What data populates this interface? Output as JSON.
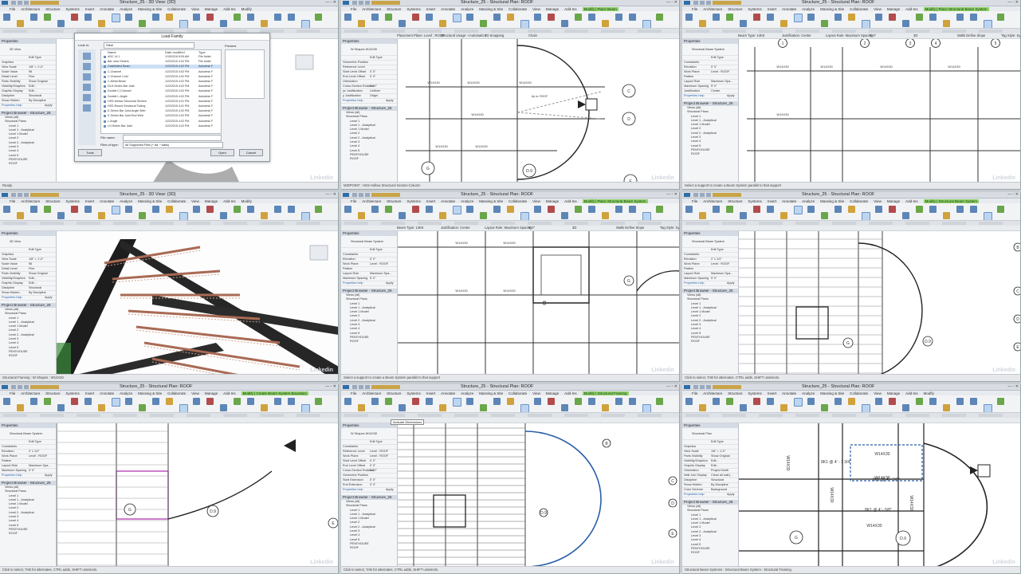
{
  "panels": [
    {
      "title": "Structure_25 - 3D View: {3D}",
      "tabs": [
        "File",
        "Architecture",
        "Structure",
        "Systems",
        "Insert",
        "Annotate",
        "Analyze",
        "Massing & Site",
        "Collaborate",
        "View",
        "Manage",
        "Add-Ins",
        "Modify"
      ],
      "properties_header": "Properties",
      "view_type": "3D View",
      "prop_rows": [
        [
          "Graphics",
          ""
        ],
        [
          "View Scale",
          "1/8\" = 1'-0\""
        ],
        [
          "Scale Value",
          "96"
        ],
        [
          "Detail Level",
          "Fine"
        ],
        [
          "Parts Visibility",
          "Show Original"
        ],
        [
          "Visibility/Graphics",
          "Edit..."
        ],
        [
          "Graphic Display",
          "Edit..."
        ],
        [
          "Discipline",
          "Structural"
        ],
        [
          "Show Hidden",
          "By Discipline"
        ]
      ],
      "browser_header": "Project Browser - Structure_25",
      "tree": [
        "Views (all)",
        "Structural Plans",
        "Level 1",
        "Level 1 - Analytical",
        "Level 1 Model",
        "Level 2",
        "Level 2 - Analytical",
        "Level 3",
        "Level 4",
        "Level 5",
        "PENTHOUSE",
        "ROOF"
      ],
      "status": "Ready",
      "dialog": {
        "title": "Load Family",
        "look_in_label": "Look in:",
        "look_in": "Steel",
        "columns": [
          "Name",
          "Date modified",
          "Type"
        ],
        "files": [
          [
            "ASC 14.1",
            "1/15/2016 8:05 AM",
            "File folder"
          ],
          [
            "Bar Joist Girders",
            "1/22/2015 4:02 PM",
            "File folder"
          ],
          [
            "Castellated Beam",
            "1/22/2015 4:02 PM",
            "Autodesk F"
          ],
          [
            "C-Channel",
            "1/22/2015 4:02 PM",
            "Autodesk F"
          ],
          [
            "C-Channel Cold",
            "1/22/2015 4:02 PM",
            "Autodesk F"
          ],
          [
            "C-Metal Beam",
            "1/22/2015 4:02 PM",
            "Autodesk F"
          ],
          [
            "DLH-Series Bar Joist",
            "1/22/2015 4:02 PM",
            "Autodesk F"
          ],
          [
            "Double C-Channel",
            "1/22/2015 4:02 PM",
            "Autodesk F"
          ],
          [
            "Double L-Angle",
            "1/22/2015 4:02 PM",
            "Autodesk F"
          ],
          [
            "HSS-Hollow Structural Section",
            "1/22/2015 4:01 PM",
            "Autodesk F"
          ],
          [
            "HSS-Round Structural Tubing",
            "1/22/2015 4:01 PM",
            "Autodesk F"
          ],
          [
            "K-Series Bar Joist-Angle Web",
            "1/22/2015 4:02 PM",
            "Autodesk F"
          ],
          [
            "K-Series Bar Joist-Rod Web",
            "1/22/2015 4:02 PM",
            "Autodesk F"
          ],
          [
            "L-Angle",
            "1/22/2015 4:02 PM",
            "Autodesk F"
          ],
          [
            "LH-Series Bar Joist",
            "1/22/2015 4:02 PM",
            "Autodesk F"
          ]
        ],
        "places": [
          "Documents",
          "My Computer",
          "My Network Places",
          "Favorites",
          "Desktop",
          "Metric Library"
        ],
        "preview_label": "Preview",
        "file_name_label": "File name:",
        "files_of_type_label": "Files of type:",
        "files_of_type": "All Supported Files (*.rfa, *.adsk)",
        "tools_label": "Tools",
        "open_label": "Open",
        "cancel_label": "Cancel"
      }
    },
    {
      "title": "Structure_25 - Structural Plan: ROOF",
      "tabs": [
        "File",
        "Architecture",
        "Structure",
        "Systems",
        "Insert",
        "Annotate",
        "Analyze",
        "Massing & Site",
        "Collaborate",
        "View",
        "Manage",
        "Add-Ins",
        "Modify | Place Beam"
      ],
      "options": [
        "Placement Plane: Level : ROOF",
        "Structural Usage: <Automatic>",
        "3D Snapping",
        "Chain"
      ],
      "properties_header": "Properties",
      "view_type": "W Shapes W14X30",
      "prop_rows": [
        [
          "Geometric Position",
          ""
        ],
        [
          "Reference Level",
          ""
        ],
        [
          "Start Level Offset",
          "0' 0\""
        ],
        [
          "End Level Offset",
          "0' 0\""
        ],
        [
          "Orientation",
          ""
        ],
        [
          "Cross-Section Rotation",
          "0.00°"
        ],
        [
          "yz Justification",
          "Uniform"
        ],
        [
          "y Justification",
          "Origin"
        ]
      ],
      "browser_header": "Project Browser - Structure_25",
      "tree": [
        "Views (all)",
        "Structural Plans",
        "Level 1",
        "Level 1 - Analytical",
        "Level 1 Model",
        "Level 2",
        "Level 2 - Analytical",
        "Level 3",
        "Level 4",
        "Level 5",
        "PENTHOUSE",
        "ROOF"
      ],
      "status": "MIDPOINT : HSS-Hollow Structural Section-Column",
      "beam_labels": [
        "W14X30",
        "W14X30",
        "W14X30",
        "W14X30",
        "W14X30",
        "W14X30"
      ],
      "grid_bubbles": [
        "C",
        "D",
        "G",
        "D.9",
        "E"
      ],
      "tip": "Up to: ROOF"
    },
    {
      "title": "Structure_25 - Structural Plan: ROOF",
      "tabs": [
        "File",
        "Architecture",
        "Structure",
        "Systems",
        "Insert",
        "Annotate",
        "Analyze",
        "Massing & Site",
        "Collaborate",
        "View",
        "Manage",
        "Add-Ins",
        "Modify | Place Structural Beam System"
      ],
      "options": [
        "Beam Type: 14K6",
        "Justification: Center",
        "Layout Rule: Maximum Spacing",
        "5' 0\"",
        "3D",
        "Walls Define Slope",
        "Tag Style: System"
      ],
      "properties_header": "Properties",
      "view_type": "Structural Beam System",
      "prop_rows": [
        [
          "Constraints",
          ""
        ],
        [
          "Elevation",
          "0' 0\""
        ],
        [
          "Work Plane",
          "Level : ROOF"
        ],
        [
          "Pattern",
          ""
        ],
        [
          "Layout Rule",
          "Maximum Spa..."
        ],
        [
          "Maximum Spacing",
          "5' 0\""
        ],
        [
          "Justification",
          "Center"
        ]
      ],
      "browser_header": "Project Browser - Structure_25",
      "tree": [
        "Views (all)",
        "Structural Plans",
        "Level 1",
        "Level 1 - Analytical",
        "Level 1 Model",
        "Level 2",
        "Level 2 - Analytical",
        "Level 3",
        "Level 4",
        "Level 5",
        "PENTHOUSE",
        "ROOF"
      ],
      "status": "Select a support to create a Beam System parallel to that support",
      "grid_bubbles": [
        "1",
        "2",
        "3",
        "4",
        "5"
      ],
      "beam_labels": [
        "W14X30",
        "W14X30",
        "W14X30",
        "W14X30",
        "W14X30"
      ]
    },
    {
      "title": "Structure_25 - 3D View: {3D}",
      "tabs": [
        "File",
        "Architecture",
        "Structure",
        "Systems",
        "Insert",
        "Annotate",
        "Analyze",
        "Massing & Site",
        "Collaborate",
        "View",
        "Manage",
        "Add-Ins",
        "Modify"
      ],
      "properties_header": "Properties",
      "view_type": "3D View",
      "prop_rows": [
        [
          "Graphics",
          ""
        ],
        [
          "View Scale",
          "1/8\" = 1'-0\""
        ],
        [
          "Scale Value",
          "96"
        ],
        [
          "Detail Level",
          "Fine"
        ],
        [
          "Parts Visibility",
          "Show Original"
        ],
        [
          "Visibility/Graphics",
          "Edit..."
        ],
        [
          "Graphic Display",
          "Edit..."
        ],
        [
          "Discipline",
          "Structural"
        ],
        [
          "Show Hidden",
          "By Discipline"
        ]
      ],
      "browser_header": "Project Browser - Structure_25",
      "tree": [
        "Views (all)",
        "Structural Plans",
        "Level 1",
        "Level 1 - Analytical",
        "Level 1 Model",
        "Level 2",
        "Level 2 - Analytical",
        "Level 3",
        "Level 4",
        "Level 5",
        "PENTHOUSE",
        "ROOF"
      ],
      "status": "Structural Framing : W Shapes : W14X30"
    },
    {
      "title": "Structure_25 - Structural Plan: ROOF",
      "tabs": [
        "File",
        "Architecture",
        "Structure",
        "Systems",
        "Insert",
        "Annotate",
        "Analyze",
        "Massing & Site",
        "Collaborate",
        "View",
        "Manage",
        "Add-Ins",
        "Modify | Place Structural Beam System"
      ],
      "options": [
        "Beam Type: 14K6",
        "Justification: Center",
        "Layout Rule: Maximum Spacing",
        "5' 0\"",
        "3D",
        "Walls Define Slope",
        "Tag Style: System"
      ],
      "properties_header": "Properties",
      "view_type": "Structural Beam System",
      "prop_rows": [
        [
          "Constraints",
          ""
        ],
        [
          "Elevation",
          "0' 0\""
        ],
        [
          "Work Plane",
          "Level : ROOF"
        ],
        [
          "Pattern",
          ""
        ],
        [
          "Layout Rule",
          "Maximum Spa..."
        ],
        [
          "Maximum Spacing",
          "5' 0\""
        ]
      ],
      "browser_header": "Project Browser - Structure_25",
      "tree": [
        "Views (all)",
        "Structural Plans",
        "Level 1",
        "Level 1 - Analytical",
        "Level 1 Model",
        "Level 2",
        "Level 2 - Analytical",
        "Level 3",
        "Level 4",
        "Level 5",
        "PENTHOUSE",
        "ROOF"
      ],
      "status": "Select a support to create a Beam System parallel to that support",
      "beam_labels": [
        "W14X30",
        "W14X30",
        "W14X30",
        "W14X30"
      ],
      "grid_bubbles": [
        "G"
      ]
    },
    {
      "title": "Structure_25 - Structural Plan: ROOF",
      "tabs": [
        "File",
        "Architecture",
        "Structure",
        "Systems",
        "Insert",
        "Annotate",
        "Analyze",
        "Massing & Site",
        "Collaborate",
        "View",
        "Manage",
        "Add-Ins",
        "Modify | Structural Beam System"
      ],
      "properties_header": "Properties",
      "view_type": "Structural Beam System",
      "prop_rows": [
        [
          "Constraints",
          ""
        ],
        [
          "Elevation",
          "2' 1 1/2\""
        ],
        [
          "Work Plane",
          "Level : ROOF"
        ],
        [
          "Pattern",
          ""
        ],
        [
          "Layout Rule",
          "Maximum Spa..."
        ],
        [
          "Maximum Spacing",
          "5' 0\""
        ]
      ],
      "browser_header": "Project Browser - Structure_25",
      "tree": [
        "Views (all)",
        "Structural Plans",
        "Level 1",
        "Level 1 - Analytical",
        "Level 1 Model",
        "Level 2",
        "Level 2 - Analytical",
        "Level 3",
        "Level 4",
        "Level 5",
        "PENTHOUSE",
        "ROOF"
      ],
      "status": "Click to select, TAB for alternates, CTRL adds, SHIFT unselects.",
      "grid_bubbles": [
        "B",
        "C",
        "D",
        "E",
        "D.9",
        "G"
      ]
    },
    {
      "title": "Structure_25 - Structural Plan: ROOF",
      "tabs": [
        "File",
        "Architecture",
        "Structure",
        "Systems",
        "Insert",
        "Annotate",
        "Analyze",
        "Massing & Site",
        "Collaborate",
        "View",
        "Manage",
        "Add-Ins",
        "Modify | Create Beam System Boundary"
      ],
      "properties_header": "Properties",
      "view_type": "Structural Beam System",
      "prop_rows": [
        [
          "Constraints",
          ""
        ],
        [
          "Elevation",
          "2' 1 1/2\""
        ],
        [
          "Work Plane",
          "Level : ROOF"
        ],
        [
          "Pattern",
          ""
        ],
        [
          "Layout Rule",
          "Maximum Spa..."
        ],
        [
          "Maximum Spacing",
          "5' 0\""
        ]
      ],
      "browser_header": "Project Browser - Structure_25",
      "tree": [
        "Views (all)",
        "Structural Plans",
        "Level 1",
        "Level 1 - Analytical",
        "Level 1 Model",
        "Level 2",
        "Level 2 - Analytical",
        "Level 3",
        "Level 4",
        "Level 5",
        "PENTHOUSE",
        "ROOF"
      ],
      "status": "Click to select, TAB for alternates, CTRL adds, SHIFT unselects.",
      "grid_bubbles": [
        "G",
        "D.9",
        "E"
      ]
    },
    {
      "title": "Structure_25 - Structural Plan: ROOF",
      "tabs": [
        "File",
        "Architecture",
        "Structure",
        "Systems",
        "Insert",
        "Annotate",
        "Analyze",
        "Massing & Site",
        "Collaborate",
        "View",
        "Manage",
        "Add-Ins",
        "Modify | Structural Framing"
      ],
      "properties_header": "Properties",
      "view_type": "W Shapes W14X30",
      "prop_rows": [
        [
          "Constraints",
          ""
        ],
        [
          "Reference Level",
          "Level : ROOF"
        ],
        [
          "Work Plane",
          "Level : ROOF"
        ],
        [
          "Start Level Offset",
          "0' 0\""
        ],
        [
          "End Level Offset",
          "0' 0\""
        ],
        [
          "Cross-Section Rotation",
          "0.00°"
        ],
        [
          "Geometric Position",
          ""
        ],
        [
          "Start Extension",
          "0' 0\""
        ],
        [
          "End Extension",
          "0' 0\""
        ]
      ],
      "browser_header": "Project Browser - Structure_25",
      "tree": [
        "Views (all)",
        "Structural Plans",
        "Level 1",
        "Level 1 - Analytical",
        "Level 1 Model",
        "Level 2",
        "Level 2 - Analytical",
        "Level 3",
        "Level 4",
        "Level 5",
        "PENTHOUSE",
        "ROOF"
      ],
      "status": "Click to select, TAB for alternates, CTRL adds, SHIFT unselects.",
      "tooltip": "Activate Dimensions",
      "grid_bubbles": [
        "B",
        "C",
        "D",
        "E",
        "D.9"
      ]
    },
    {
      "title": "Structure_25 - Structural Plan: ROOF",
      "tabs": [
        "File",
        "Architecture",
        "Structure",
        "Systems",
        "Insert",
        "Annotate",
        "Analyze",
        "Massing & Site",
        "Collaborate",
        "View",
        "Manage",
        "Add-Ins",
        "Modify"
      ],
      "properties_header": "Properties",
      "view_type": "Structural Plan",
      "prop_rows": [
        [
          "Graphics",
          ""
        ],
        [
          "View Scale",
          "1/8\" = 1'-0\""
        ],
        [
          "Parts Visibility",
          "Show Original"
        ],
        [
          "Visibility/Graphics",
          "Edit..."
        ],
        [
          "Graphic Display",
          "Edit..."
        ],
        [
          "Orientation",
          "Project North"
        ],
        [
          "Wall Join Display",
          "Clean all wall j..."
        ],
        [
          "Discipline",
          "Structural"
        ],
        [
          "Show Hidden",
          "By Discipline"
        ],
        [
          "Color Scheme",
          "Background"
        ]
      ],
      "browser_header": "Project Browser - Structure_25",
      "tree": [
        "Views (all)",
        "Structural Plans",
        "Level 1",
        "Level 1 - Analytical",
        "Level 1 Model",
        "Level 2",
        "Level 2 - Analytical",
        "Level 3",
        "Level 4",
        "Level 5",
        "PENTHOUSE",
        "ROOF"
      ],
      "status": "Structural Beam Systems : Structural Beam System : Structural Framing",
      "beam_labels": [
        "W14X30",
        "W14X30",
        "W14X30",
        "W14X30",
        "W14X30",
        "W14X30"
      ],
      "system_labels": [
        "8K1 @ 4' - 1 3/4\"",
        "8K1 @ 4' - 5/8\"",
        "8K1 @ 4' - 5/8\""
      ],
      "grid_bubbles": [
        "G",
        "D.9"
      ]
    }
  ],
  "common": {
    "scale": "1/8\" = 1'-0\"",
    "watermark": "Linkedin",
    "apply_label": "Apply",
    "properties_help": "Properties help",
    "edit_type": "Edit Type"
  }
}
